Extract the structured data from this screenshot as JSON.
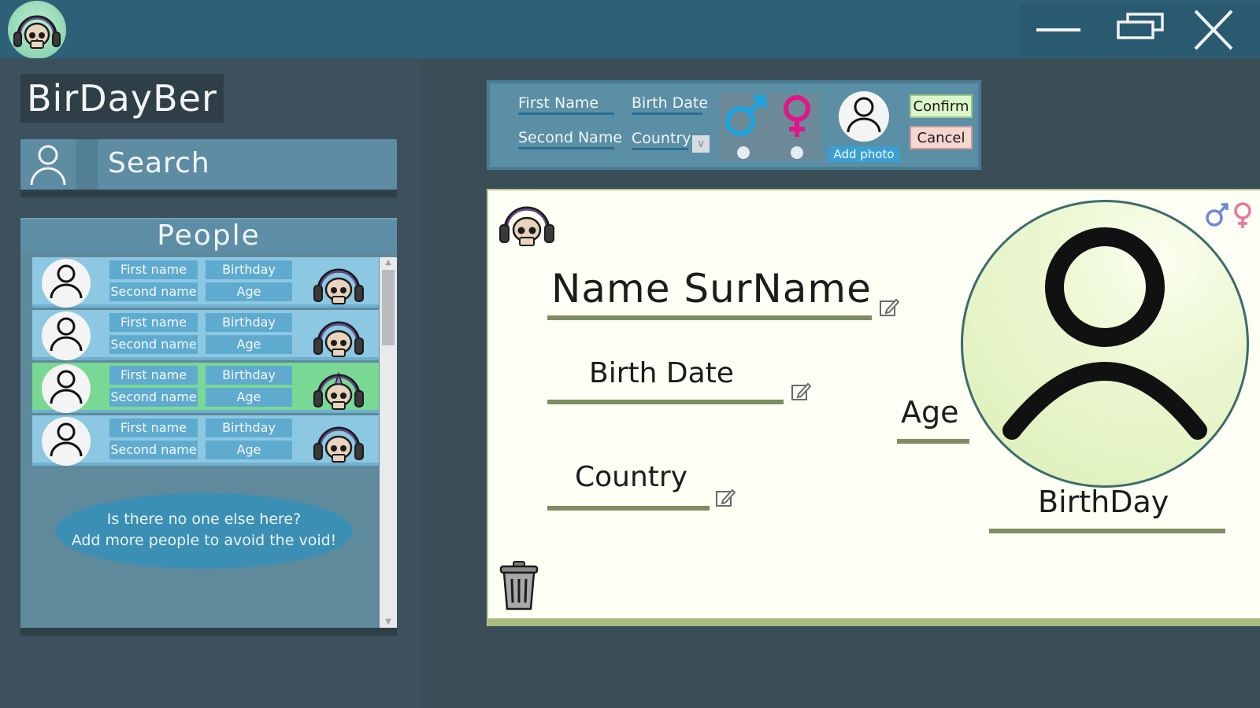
{
  "app": {
    "title": "BirDayBer"
  },
  "window_controls": {
    "minimize": "minimize",
    "restore": "restore",
    "close": "close"
  },
  "sidebar": {
    "search_label": "Search",
    "people_header": "People",
    "people": [
      {
        "first_name": "First name",
        "second_name": "Second name",
        "birthday": "Birthday",
        "age": "Age",
        "selected": false
      },
      {
        "first_name": "First name",
        "second_name": "Second name",
        "birthday": "Birthday",
        "age": "Age",
        "selected": false
      },
      {
        "first_name": "First name",
        "second_name": "Second name",
        "birthday": "Birthday",
        "age": "Age",
        "selected": true
      },
      {
        "first_name": "First name",
        "second_name": "Second name",
        "birthday": "Birthday",
        "age": "Age",
        "selected": false
      }
    ],
    "empty_message_line1": "Is there no one else here?",
    "empty_message_line2": "Add more people to avoid the void!"
  },
  "form": {
    "first_name": "First Name",
    "second_name": "Second Name",
    "birth_date": "Birth Date",
    "country": "Country",
    "add_photo": "Add photo",
    "confirm": "Confirm",
    "cancel": "Cancel"
  },
  "card": {
    "name": "Name SurName",
    "birth_date": "Birth Date",
    "country": "Country",
    "age": "Age",
    "birthday": "BirthDay"
  },
  "colors": {
    "male": "#1aa5e0",
    "female": "#e0168a",
    "selected_row": "#79d893",
    "row": "#8dc8e2"
  },
  "icons": [
    "skull-headphones-icon",
    "user-icon",
    "male-icon",
    "female-icon",
    "edit-icon",
    "trash-icon",
    "minimize-icon",
    "restore-icon",
    "close-icon"
  ]
}
